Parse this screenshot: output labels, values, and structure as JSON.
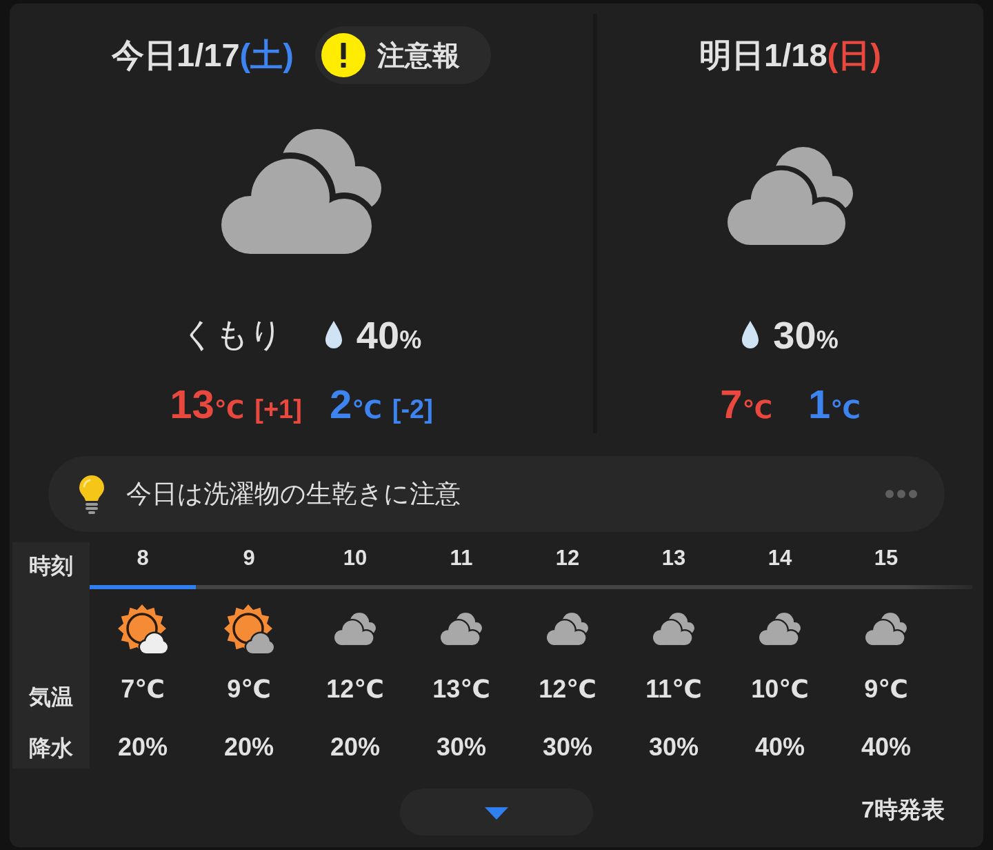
{
  "days": [
    {
      "label": "今日1/17",
      "weekday": "(土)",
      "color": "#3d84f0",
      "alert": {
        "label": "注意報"
      },
      "kind": "cloudy",
      "weather": "くもり",
      "precip": {
        "value": "40",
        "unit": "%"
      },
      "high": {
        "value": "13",
        "unit": "℃",
        "diff": "[+1]"
      },
      "low": {
        "value": "2",
        "unit": "℃",
        "diff": "[-2]"
      }
    },
    {
      "label": "明日1/18",
      "weekday": "(日)",
      "color": "#e8483e",
      "kind": "cloudy",
      "precip": {
        "value": "30",
        "unit": "%"
      },
      "high": {
        "value": "7",
        "unit": "℃"
      },
      "low": {
        "value": "1",
        "unit": "℃"
      }
    }
  ],
  "tip": {
    "text": "今日は洗濯物の生乾きに注意"
  },
  "hourly": {
    "row_labels": [
      "時刻",
      "気温",
      "降水"
    ],
    "hours": [
      {
        "hour": "8",
        "current": true,
        "kind": "sun_cloud_light",
        "temp": "7℃",
        "precip": "20%"
      },
      {
        "hour": "9",
        "current": false,
        "kind": "sun_cloud_gray",
        "temp": "9℃",
        "precip": "20%"
      },
      {
        "hour": "10",
        "current": false,
        "kind": "cloudy",
        "temp": "12℃",
        "precip": "20%"
      },
      {
        "hour": "11",
        "current": false,
        "kind": "cloudy",
        "temp": "13℃",
        "precip": "30%"
      },
      {
        "hour": "12",
        "current": false,
        "kind": "cloudy",
        "temp": "12℃",
        "precip": "30%"
      },
      {
        "hour": "13",
        "current": false,
        "kind": "cloudy",
        "temp": "11℃",
        "precip": "30%"
      },
      {
        "hour": "14",
        "current": false,
        "kind": "cloudy",
        "temp": "10℃",
        "precip": "40%"
      },
      {
        "hour": "15",
        "current": false,
        "kind": "cloudy",
        "temp": "9℃",
        "precip": "40%"
      }
    ]
  },
  "footer": {
    "issued": "7時発表"
  }
}
